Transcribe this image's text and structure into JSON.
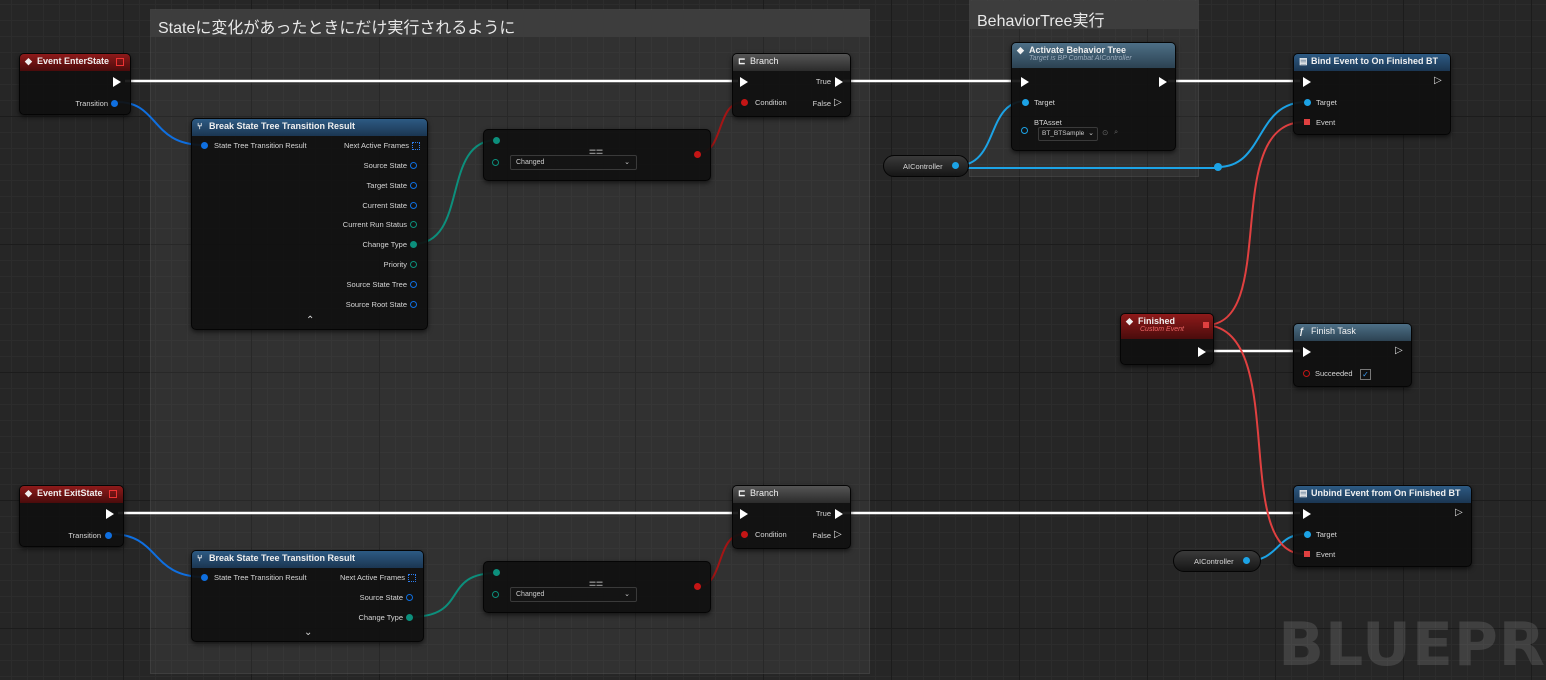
{
  "comments": [
    {
      "title": "Stateに変化があったときにだけ実行されるように"
    },
    {
      "title": "BehaviorTree実行"
    }
  ],
  "nodes": {
    "enter_event": {
      "title": "Event EnterState",
      "pin_transition": "Transition"
    },
    "exit_event": {
      "title": "Event ExitState",
      "pin_transition": "Transition"
    },
    "break_top": {
      "title": "Break State Tree Transition Result",
      "input": "State Tree Transition Result",
      "outputs": [
        "Next Active Frames",
        "Source State",
        "Target State",
        "Current State",
        "Current Run Status",
        "Change Type",
        "Priority",
        "Source State Tree",
        "Source Root State"
      ],
      "collapse_glyph": "⌃"
    },
    "break_bottom": {
      "title": "Break State Tree Transition Result",
      "input": "State Tree Transition Result",
      "outputs": [
        "Next Active Frames",
        "Source State",
        "Change Type"
      ],
      "expand_glyph": "⌄"
    },
    "equal_top": {
      "op": "==",
      "value": "Changed"
    },
    "equal_bottom": {
      "op": "==",
      "value": "Changed"
    },
    "branch_top": {
      "title": "Branch",
      "condition": "Condition",
      "true_label": "True",
      "false_label": "False"
    },
    "branch_bottom": {
      "title": "Branch",
      "condition": "Condition",
      "true_label": "True",
      "false_label": "False"
    },
    "activate_bt": {
      "title": "Activate Behavior Tree",
      "subtitle": "Target is BP Combat AIController",
      "target": "Target",
      "btasset": "BTAsset",
      "btasset_value": "BT_BTSample"
    },
    "aicontroller_top": {
      "label": "AIController"
    },
    "aicontroller_bottom": {
      "label": "AIController"
    },
    "bind_event": {
      "title": "Bind Event to On Finished BT",
      "target": "Target",
      "event": "Event"
    },
    "finished_event": {
      "title": "Finished",
      "subtitle": "Custom Event"
    },
    "finish_task": {
      "title": "Finish Task",
      "succeeded": "Succeeded",
      "checked": true
    },
    "unbind_event": {
      "title": "Unbind Event from On Finished BT",
      "target": "Target",
      "event": "Event"
    }
  },
  "watermark": "BLUEPR",
  "colors": {
    "exec": "#ffffff",
    "struct": "#0f6fe0",
    "enum": "#0c8f7c",
    "bool": "#c41515",
    "object": "#1ca3e6",
    "delegate": "#e04040"
  }
}
